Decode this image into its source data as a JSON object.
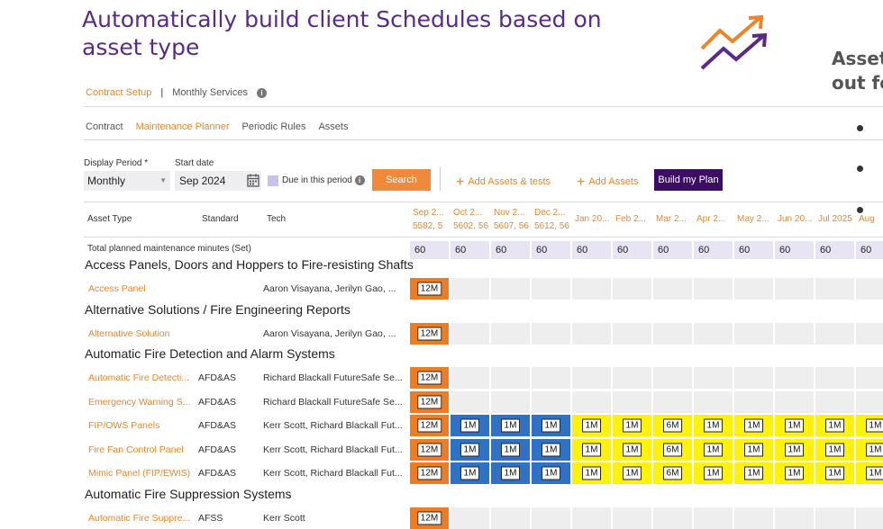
{
  "headline": "Automatically build  client Schedules based on asset type",
  "side_text": "Asset\nout fo",
  "top_tabs": {
    "active": "Contract Setup",
    "separator": "|",
    "other": "Monthly Services"
  },
  "sub_tabs": [
    "Contract",
    "Maintenance Planner",
    "Periodic Rules",
    "Assets"
  ],
  "active_sub_tab": "Maintenance Planner",
  "filters": {
    "display_period_label": "Display Period *",
    "display_period_value": "Monthly",
    "start_date_label": "Start date",
    "start_date_value": "Sep 2024",
    "due_label": "Due in this period",
    "search_label": "Search",
    "add_assets_tests_label": "Add Assets & tests",
    "add_assets_label": "Add Assets",
    "build_label": "Build my Plan"
  },
  "table": {
    "headers": {
      "asset_type": "Asset Type",
      "standard": "Standard",
      "tech": "Tech"
    },
    "months": [
      {
        "line1": "Sep 2...",
        "line2": "5582, 5"
      },
      {
        "line1": "Oct 2...",
        "line2": "5602, 56"
      },
      {
        "line1": "Nov 2...",
        "line2": "5607, 56"
      },
      {
        "line1": "Dec 2...",
        "line2": "5612, 56"
      },
      {
        "line1": "Jan 20...",
        "line2": ""
      },
      {
        "line1": "Feb 2...",
        "line2": ""
      },
      {
        "line1": "Mar 2...",
        "line2": ""
      },
      {
        "line1": "Apr 2...",
        "line2": ""
      },
      {
        "line1": "May 2...",
        "line2": ""
      },
      {
        "line1": "Jun 20...",
        "line2": ""
      },
      {
        "line1": "Jul 2025",
        "line2": ""
      },
      {
        "line1": "Aug",
        "line2": ""
      }
    ],
    "total_label": "Total planned maintenance minutes (Set)",
    "totals": [
      "60",
      "60",
      "60",
      "60",
      "60",
      "60",
      "60",
      "60",
      "60",
      "60",
      "60",
      "60"
    ],
    "groups": [
      {
        "title": "Access Panels, Doors and Hoppers to Fire-resisting Shafts",
        "rows": [
          {
            "name": "Access Panel",
            "standard": "",
            "tech": "Aaron Visayana, Jerilyn Gao, ...",
            "cells": [
              [
                "orange",
                "12M"
              ],
              [
                "empty",
                ""
              ],
              [
                "empty",
                ""
              ],
              [
                "empty",
                ""
              ],
              [
                "empty",
                ""
              ],
              [
                "empty",
                ""
              ],
              [
                "empty",
                ""
              ],
              [
                "empty",
                ""
              ],
              [
                "empty",
                ""
              ],
              [
                "empty",
                ""
              ],
              [
                "empty",
                ""
              ],
              [
                "empty",
                ""
              ]
            ]
          }
        ]
      },
      {
        "title": "Alternative Solutions / Fire Engineering Reports",
        "rows": [
          {
            "name": "Alternative Solution",
            "standard": "",
            "tech": "Aaron Visayana, Jerilyn Gao, ...",
            "cells": [
              [
                "orange",
                "12M"
              ],
              [
                "empty",
                ""
              ],
              [
                "empty",
                ""
              ],
              [
                "empty",
                ""
              ],
              [
                "empty",
                ""
              ],
              [
                "empty",
                ""
              ],
              [
                "empty",
                ""
              ],
              [
                "empty",
                ""
              ],
              [
                "empty",
                ""
              ],
              [
                "empty",
                ""
              ],
              [
                "empty",
                ""
              ],
              [
                "empty",
                ""
              ]
            ]
          }
        ]
      },
      {
        "title": "Automatic Fire Detection and Alarm Systems",
        "rows": [
          {
            "name": "Automatic Fire Detecti...",
            "standard": "AFD&AS",
            "tech": "Richard Blackall FutureSafe Se...",
            "cells": [
              [
                "orange",
                "12M"
              ],
              [
                "empty",
                ""
              ],
              [
                "empty",
                ""
              ],
              [
                "empty",
                ""
              ],
              [
                "empty",
                ""
              ],
              [
                "empty",
                ""
              ],
              [
                "empty",
                ""
              ],
              [
                "empty",
                ""
              ],
              [
                "empty",
                ""
              ],
              [
                "empty",
                ""
              ],
              [
                "empty",
                ""
              ],
              [
                "empty",
                ""
              ]
            ]
          },
          {
            "name": "Emergency Warning S...",
            "standard": "AFD&AS",
            "tech": "Richard Blackall FutureSafe Se...",
            "cells": [
              [
                "orange",
                "12M"
              ],
              [
                "empty",
                ""
              ],
              [
                "empty",
                ""
              ],
              [
                "empty",
                ""
              ],
              [
                "empty",
                ""
              ],
              [
                "empty",
                ""
              ],
              [
                "empty",
                ""
              ],
              [
                "empty",
                ""
              ],
              [
                "empty",
                ""
              ],
              [
                "empty",
                ""
              ],
              [
                "empty",
                ""
              ],
              [
                "empty",
                ""
              ]
            ]
          },
          {
            "name": "FIP/OWS Panels",
            "standard": "AFD&AS",
            "tech": "Kerr Scott, Richard Blackall Fut...",
            "cells": [
              [
                "orange",
                "12M"
              ],
              [
                "blue",
                "1M"
              ],
              [
                "blue",
                "1M"
              ],
              [
                "blue",
                "1M"
              ],
              [
                "yellow",
                "1M"
              ],
              [
                "yellow",
                "1M"
              ],
              [
                "yellow",
                "6M"
              ],
              [
                "yellow",
                "1M"
              ],
              [
                "yellow",
                "1M"
              ],
              [
                "yellow",
                "1M"
              ],
              [
                "yellow",
                "1M"
              ],
              [
                "yellow",
                "1M"
              ]
            ]
          },
          {
            "name": "Fire Fan Control Panel",
            "standard": "AFD&AS",
            "tech": "Kerr Scott, Richard Blackall Fut...",
            "cells": [
              [
                "orange",
                "12M"
              ],
              [
                "blue",
                "1M"
              ],
              [
                "blue",
                "1M"
              ],
              [
                "blue",
                "1M"
              ],
              [
                "yellow",
                "1M"
              ],
              [
                "yellow",
                "1M"
              ],
              [
                "yellow",
                "6M"
              ],
              [
                "yellow",
                "1M"
              ],
              [
                "yellow",
                "1M"
              ],
              [
                "yellow",
                "1M"
              ],
              [
                "yellow",
                "1M"
              ],
              [
                "yellow",
                "1M"
              ]
            ]
          },
          {
            "name": "Mimic Panel (FIP/EWIS)",
            "standard": "AFD&AS",
            "tech": "Kerr Scott, Richard Blackall Fut...",
            "cells": [
              [
                "orange",
                "12M"
              ],
              [
                "blue",
                "1M"
              ],
              [
                "blue",
                "1M"
              ],
              [
                "blue",
                "1M"
              ],
              [
                "yellow",
                "1M"
              ],
              [
                "yellow",
                "1M"
              ],
              [
                "yellow",
                "6M"
              ],
              [
                "yellow",
                "1M"
              ],
              [
                "yellow",
                "1M"
              ],
              [
                "yellow",
                "1M"
              ],
              [
                "yellow",
                "1M"
              ],
              [
                "yellow",
                "1M"
              ]
            ]
          }
        ]
      },
      {
        "title": "Automatic Fire Suppression Systems",
        "rows": [
          {
            "name": "Automatic Fire Suppre...",
            "standard": "AFSS",
            "tech": "Kerr Scott",
            "cells": [
              [
                "orange",
                "12M"
              ],
              [
                "empty",
                ""
              ],
              [
                "empty",
                ""
              ],
              [
                "empty",
                ""
              ],
              [
                "empty",
                ""
              ],
              [
                "empty",
                ""
              ],
              [
                "empty",
                ""
              ],
              [
                "empty",
                ""
              ],
              [
                "empty",
                ""
              ],
              [
                "empty",
                ""
              ],
              [
                "empty",
                ""
              ],
              [
                "empty",
                ""
              ]
            ]
          }
        ]
      }
    ]
  },
  "colors": {
    "accent": "#e8862d",
    "brand": "#3b0d63",
    "orange": "#ee7d22",
    "blue": "#2f72c4",
    "yellow": "#fff20a"
  },
  "icons": [
    "info-icon",
    "calendar-icon",
    "plus-icon",
    "trend-arrows-logo-icon",
    "dropdown-caret-icon"
  ]
}
